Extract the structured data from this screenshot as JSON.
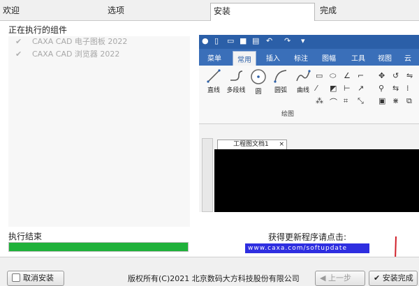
{
  "tabs": [
    {
      "label": "欢迎",
      "active": false
    },
    {
      "label": "选项",
      "active": false
    },
    {
      "label": "安装",
      "active": true
    },
    {
      "label": "完成",
      "active": false
    }
  ],
  "main": {
    "section_title": "正在执行的组件",
    "components": [
      {
        "label": "CAXA CAD 电子图板 2022",
        "checked": true
      },
      {
        "label": "CAXA CAD 浏览器 2022",
        "checked": true
      }
    ],
    "done_label": "执行结束",
    "progress_percent": 100
  },
  "screenshot": {
    "ribbon_tabs": [
      "菜单",
      "常用",
      "插入",
      "标注",
      "图幅",
      "工具",
      "视图",
      "云"
    ],
    "active_tab": "常用",
    "tools": [
      "直线",
      "多段线",
      "圆",
      "圆弧",
      "曲线"
    ],
    "group_label": "绘图",
    "doc_tab": "工程图文档1"
  },
  "update": {
    "hint": "获得更新程序请点击:",
    "link_text": "www.caxa.com/softupdate"
  },
  "footer": {
    "cancel_label": "取消安装",
    "copyright": "版权所有(C)2021 北京数码大方科技股份有限公司",
    "prev_label": "上一步",
    "finish_label": "安装完成"
  },
  "colors": {
    "progress": "#1fb13a",
    "ribbon": "#2b5fa8",
    "arrow": "#d0202a"
  }
}
